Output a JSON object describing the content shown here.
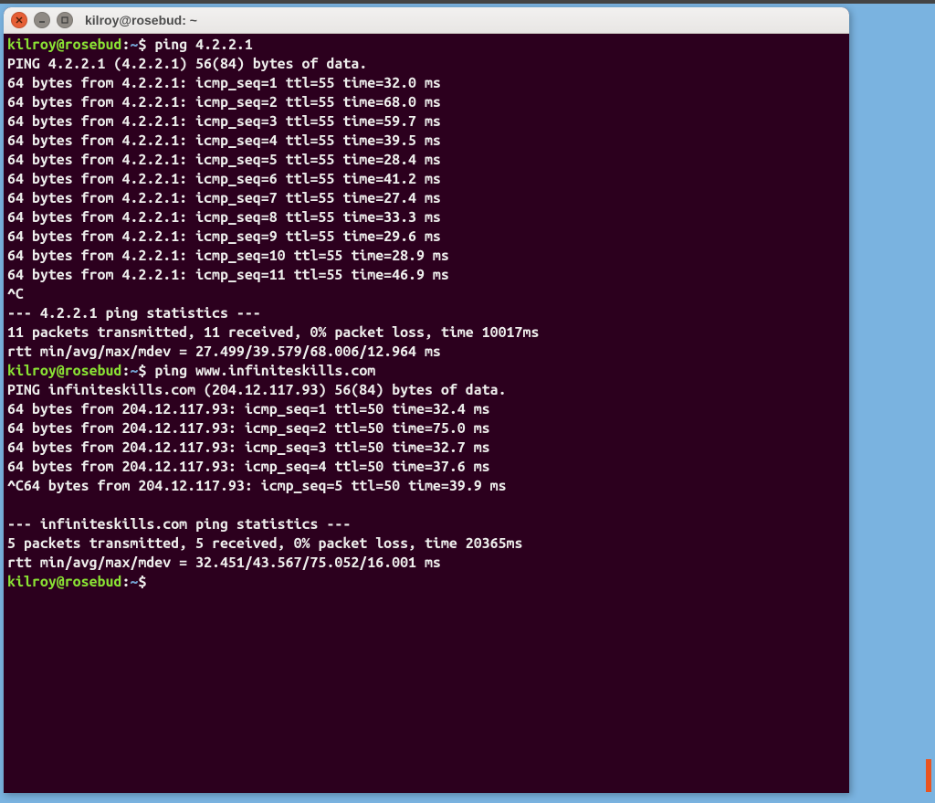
{
  "title": "kilroy@rosebud: ~",
  "prompt": {
    "userhost": "kilroy@rosebud",
    "path": "~",
    "sep": ":",
    "dollar": "$"
  },
  "commands": {
    "cmd1": "ping 4.2.2.1",
    "cmd2": "ping www.infiniteskills.com"
  },
  "ping1": {
    "header": "PING 4.2.2.1 (4.2.2.1) 56(84) bytes of data.",
    "replies": [
      "64 bytes from 4.2.2.1: icmp_seq=1 ttl=55 time=32.0 ms",
      "64 bytes from 4.2.2.1: icmp_seq=2 ttl=55 time=68.0 ms",
      "64 bytes from 4.2.2.1: icmp_seq=3 ttl=55 time=59.7 ms",
      "64 bytes from 4.2.2.1: icmp_seq=4 ttl=55 time=39.5 ms",
      "64 bytes from 4.2.2.1: icmp_seq=5 ttl=55 time=28.4 ms",
      "64 bytes from 4.2.2.1: icmp_seq=6 ttl=55 time=41.2 ms",
      "64 bytes from 4.2.2.1: icmp_seq=7 ttl=55 time=27.4 ms",
      "64 bytes from 4.2.2.1: icmp_seq=8 ttl=55 time=33.3 ms",
      "64 bytes from 4.2.2.1: icmp_seq=9 ttl=55 time=29.6 ms",
      "64 bytes from 4.2.2.1: icmp_seq=10 ttl=55 time=28.9 ms",
      "64 bytes from 4.2.2.1: icmp_seq=11 ttl=55 time=46.9 ms"
    ],
    "interrupt": "^C",
    "stats_hdr": "--- 4.2.2.1 ping statistics ---",
    "stats1": "11 packets transmitted, 11 received, 0% packet loss, time 10017ms",
    "stats2": "rtt min/avg/max/mdev = 27.499/39.579/68.006/12.964 ms"
  },
  "ping2": {
    "header": "PING infiniteskills.com (204.12.117.93) 56(84) bytes of data.",
    "replies": [
      "64 bytes from 204.12.117.93: icmp_seq=1 ttl=50 time=32.4 ms",
      "64 bytes from 204.12.117.93: icmp_seq=2 ttl=50 time=75.0 ms",
      "64 bytes from 204.12.117.93: icmp_seq=3 ttl=50 time=32.7 ms",
      "64 bytes from 204.12.117.93: icmp_seq=4 ttl=50 time=37.6 ms"
    ],
    "int_reply": "^C64 bytes from 204.12.117.93: icmp_seq=5 ttl=50 time=39.9 ms",
    "blank": "",
    "stats_hdr": "--- infiniteskills.com ping statistics ---",
    "stats1": "5 packets transmitted, 5 received, 0% packet loss, time 20365ms",
    "stats2": "rtt min/avg/max/mdev = 32.451/43.567/75.052/16.001 ms"
  }
}
